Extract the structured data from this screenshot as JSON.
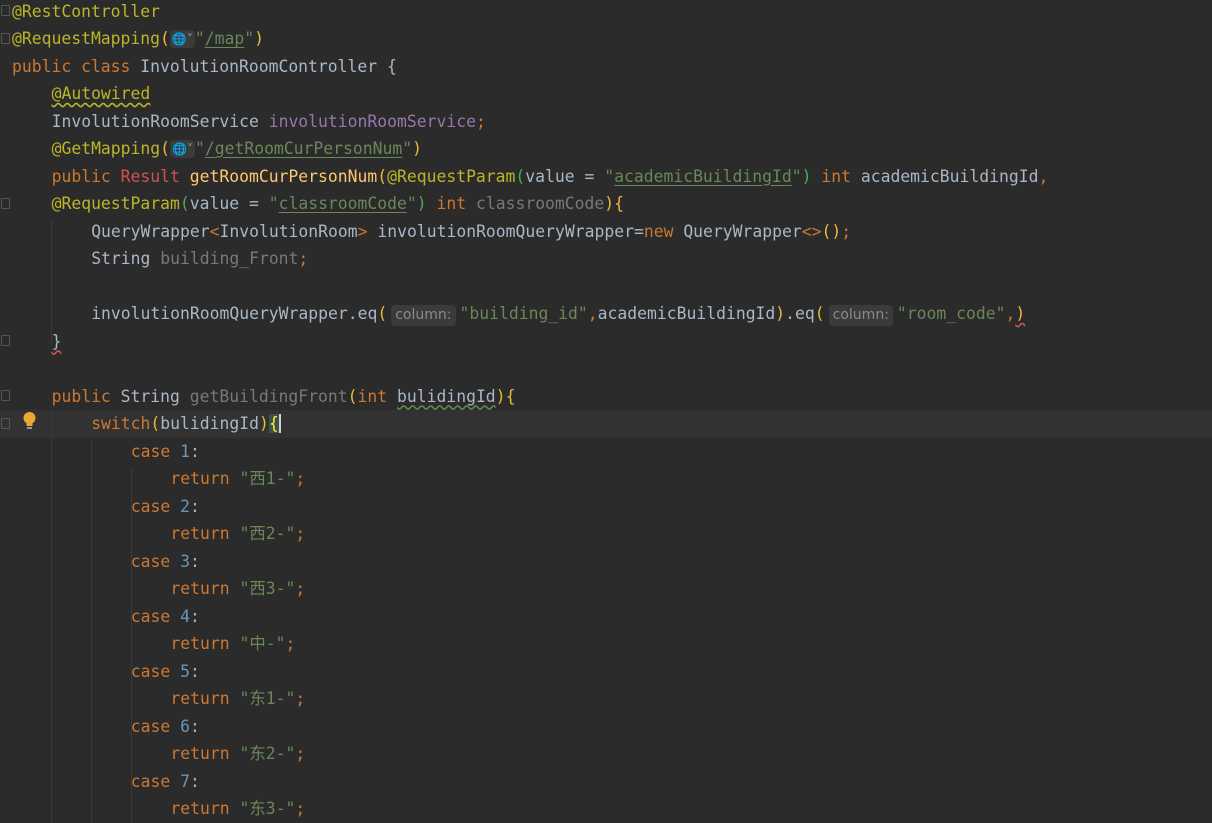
{
  "editor": {
    "current_line": 15,
    "lines": [
      {
        "indent": 0,
        "tokens": [
          {
            "c": "ann",
            "t": "@RestController"
          }
        ]
      },
      {
        "indent": 0,
        "tokens": [
          {
            "c": "ann",
            "t": "@RequestMapping"
          },
          {
            "c": "par",
            "t": "("
          },
          {
            "c": "globe",
            "t": "🌐˅"
          },
          {
            "c": "str",
            "t": "\""
          },
          {
            "c": "strl",
            "t": "/map"
          },
          {
            "c": "str",
            "t": "\""
          },
          {
            "c": "par",
            "t": ")"
          }
        ]
      },
      {
        "indent": 0,
        "tokens": [
          {
            "c": "kw",
            "t": "public class "
          },
          {
            "c": "pl",
            "t": "InvolutionRoomController {"
          }
        ]
      },
      {
        "indent": 4,
        "tokens": [
          {
            "c": "ann warn",
            "t": "@Autowired"
          }
        ]
      },
      {
        "indent": 4,
        "tokens": [
          {
            "c": "pl",
            "t": "InvolutionRoomService "
          },
          {
            "c": "fld",
            "t": "involutionRoomService"
          },
          {
            "c": "kw",
            "t": ";"
          }
        ]
      },
      {
        "indent": 4,
        "tokens": [
          {
            "c": "ann",
            "t": "@GetMapping"
          },
          {
            "c": "par",
            "t": "("
          },
          {
            "c": "globe",
            "t": "🌐˅"
          },
          {
            "c": "str",
            "t": "\""
          },
          {
            "c": "strl",
            "t": "/getRoomCurPersonNum"
          },
          {
            "c": "str",
            "t": "\""
          },
          {
            "c": "par",
            "t": ")"
          }
        ]
      },
      {
        "indent": 4,
        "tokens": [
          {
            "c": "kw",
            "t": "public "
          },
          {
            "c": "red",
            "t": "Result "
          },
          {
            "c": "mth",
            "t": "getRoomCurPersonNum"
          },
          {
            "c": "par",
            "t": "("
          },
          {
            "c": "ann",
            "t": "@RequestParam"
          },
          {
            "c": "parg",
            "t": "("
          },
          {
            "c": "pl",
            "t": "value = "
          },
          {
            "c": "str",
            "t": "\""
          },
          {
            "c": "strl",
            "t": "academicBuildingId"
          },
          {
            "c": "str",
            "t": "\""
          },
          {
            "c": "parg",
            "t": ")"
          },
          {
            "c": "kw",
            "t": " int "
          },
          {
            "c": "pl",
            "t": "academicBuildingId"
          },
          {
            "c": "kw",
            "t": ","
          }
        ]
      },
      {
        "indent": 4,
        "tokens": [
          {
            "c": "ann",
            "t": "@RequestParam"
          },
          {
            "c": "parg",
            "t": "("
          },
          {
            "c": "pl",
            "t": "value = "
          },
          {
            "c": "str",
            "t": "\""
          },
          {
            "c": "strl",
            "t": "classroomCode"
          },
          {
            "c": "str",
            "t": "\""
          },
          {
            "c": "parg",
            "t": ")"
          },
          {
            "c": "kw",
            "t": " int "
          },
          {
            "c": "gray",
            "t": "classroomCode"
          },
          {
            "c": "par",
            "t": ")"
          },
          {
            "c": "par",
            "t": "{"
          }
        ]
      },
      {
        "indent": 8,
        "tokens": [
          {
            "c": "pl",
            "t": "QueryWrapper"
          },
          {
            "c": "kw",
            "t": "<"
          },
          {
            "c": "pl",
            "t": "InvolutionRoom"
          },
          {
            "c": "kw",
            "t": ">"
          },
          {
            "c": "pl",
            "t": " involutionRoomQueryWrapper="
          },
          {
            "c": "kw",
            "t": "new "
          },
          {
            "c": "pl",
            "t": "QueryWrapper"
          },
          {
            "c": "kw",
            "t": "<>"
          },
          {
            "c": "par",
            "t": "()"
          },
          {
            "c": "kw",
            "t": ";"
          }
        ]
      },
      {
        "indent": 8,
        "tokens": [
          {
            "c": "pl",
            "t": "String "
          },
          {
            "c": "gray",
            "t": "building_Front"
          },
          {
            "c": "kw",
            "t": ";"
          }
        ]
      },
      {
        "indent": 0,
        "tokens": []
      },
      {
        "indent": 8,
        "tokens": [
          {
            "c": "pl",
            "t": "involutionRoomQueryWrapper.eq"
          },
          {
            "c": "par",
            "t": "("
          },
          {
            "c": "hint",
            "t": "column:"
          },
          {
            "c": "str",
            "t": "\"building_id\""
          },
          {
            "c": "kw",
            "t": ","
          },
          {
            "c": "pl",
            "t": "academicBuildingId"
          },
          {
            "c": "par",
            "t": ")"
          },
          {
            "c": "pl",
            "t": ".eq"
          },
          {
            "c": "par",
            "t": "("
          },
          {
            "c": "hint",
            "t": "column:"
          },
          {
            "c": "str",
            "t": "\"room_code\""
          },
          {
            "c": "kw",
            "t": ","
          },
          {
            "c": "par err",
            "t": ")"
          }
        ]
      },
      {
        "indent": 4,
        "tokens": [
          {
            "c": "pl err",
            "t": "}"
          }
        ]
      },
      {
        "indent": 0,
        "tokens": []
      },
      {
        "indent": 4,
        "tokens": [
          {
            "c": "kw",
            "t": "public "
          },
          {
            "c": "pl",
            "t": "String "
          },
          {
            "c": "gray",
            "t": "getBuildingFront"
          },
          {
            "c": "par",
            "t": "("
          },
          {
            "c": "kw",
            "t": "int "
          },
          {
            "c": "pl warng",
            "t": "bulidingId"
          },
          {
            "c": "par",
            "t": ")"
          },
          {
            "c": "par",
            "t": "{"
          }
        ]
      },
      {
        "indent": 8,
        "tokens": [
          {
            "c": "kw",
            "t": "switch"
          },
          {
            "c": "par",
            "t": "("
          },
          {
            "c": "pl",
            "t": "bulidingId"
          },
          {
            "c": "par",
            "t": ")"
          },
          {
            "c": "caretb",
            "t": "{"
          }
        ]
      },
      {
        "indent": 12,
        "tokens": [
          {
            "c": "kw",
            "t": "case "
          },
          {
            "c": "num",
            "t": "1"
          },
          {
            "c": "pl",
            "t": ":"
          }
        ]
      },
      {
        "indent": 16,
        "tokens": [
          {
            "c": "kw",
            "t": "return "
          },
          {
            "c": "str",
            "t": "\"西1-\""
          },
          {
            "c": "kw",
            "t": ";"
          }
        ]
      },
      {
        "indent": 12,
        "tokens": [
          {
            "c": "kw",
            "t": "case "
          },
          {
            "c": "num",
            "t": "2"
          },
          {
            "c": "pl",
            "t": ":"
          }
        ]
      },
      {
        "indent": 16,
        "tokens": [
          {
            "c": "kw",
            "t": "return "
          },
          {
            "c": "str",
            "t": "\"西2-\""
          },
          {
            "c": "kw",
            "t": ";"
          }
        ]
      },
      {
        "indent": 12,
        "tokens": [
          {
            "c": "kw",
            "t": "case "
          },
          {
            "c": "num",
            "t": "3"
          },
          {
            "c": "pl",
            "t": ":"
          }
        ]
      },
      {
        "indent": 16,
        "tokens": [
          {
            "c": "kw",
            "t": "return "
          },
          {
            "c": "str",
            "t": "\"西3-\""
          },
          {
            "c": "kw",
            "t": ";"
          }
        ]
      },
      {
        "indent": 12,
        "tokens": [
          {
            "c": "kw",
            "t": "case "
          },
          {
            "c": "num",
            "t": "4"
          },
          {
            "c": "pl",
            "t": ":"
          }
        ]
      },
      {
        "indent": 16,
        "tokens": [
          {
            "c": "kw",
            "t": "return "
          },
          {
            "c": "str",
            "t": "\"中-\""
          },
          {
            "c": "kw",
            "t": ";"
          }
        ]
      },
      {
        "indent": 12,
        "tokens": [
          {
            "c": "kw",
            "t": "case "
          },
          {
            "c": "num",
            "t": "5"
          },
          {
            "c": "pl",
            "t": ":"
          }
        ]
      },
      {
        "indent": 16,
        "tokens": [
          {
            "c": "kw",
            "t": "return "
          },
          {
            "c": "str",
            "t": "\"东1-\""
          },
          {
            "c": "kw",
            "t": ";"
          }
        ]
      },
      {
        "indent": 12,
        "tokens": [
          {
            "c": "kw",
            "t": "case "
          },
          {
            "c": "num",
            "t": "6"
          },
          {
            "c": "pl",
            "t": ":"
          }
        ]
      },
      {
        "indent": 16,
        "tokens": [
          {
            "c": "kw",
            "t": "return "
          },
          {
            "c": "str",
            "t": "\"东2-\""
          },
          {
            "c": "kw",
            "t": ";"
          }
        ]
      },
      {
        "indent": 12,
        "tokens": [
          {
            "c": "kw",
            "t": "case "
          },
          {
            "c": "num",
            "t": "7"
          },
          {
            "c": "pl",
            "t": ":"
          }
        ]
      },
      {
        "indent": 16,
        "tokens": [
          {
            "c": "kw",
            "t": "return "
          },
          {
            "c": "str",
            "t": "\"东3-\""
          },
          {
            "c": "kw",
            "t": ";"
          }
        ]
      }
    ]
  }
}
